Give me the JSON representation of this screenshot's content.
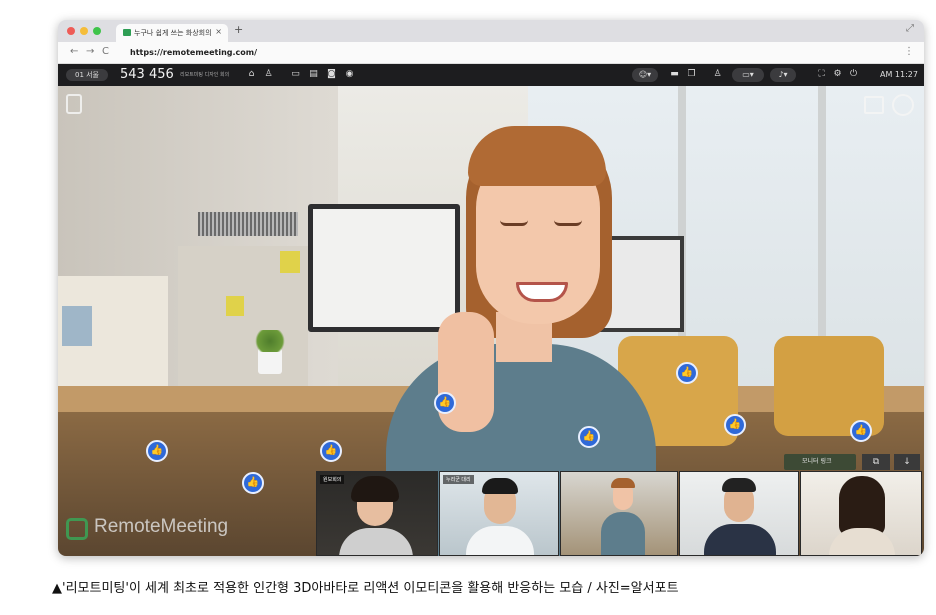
{
  "browser": {
    "tab_title": "누구나 쉽게 쓰는 화상회의",
    "tab_close": "×",
    "new_tab": "+",
    "url": "https://remotemeeting.com/",
    "back": "←",
    "forward": "→",
    "reload": "C"
  },
  "toolbar": {
    "room_tag": "01 서울",
    "room_number": "543 456",
    "room_desc": "리모트미팅 디자인 회의",
    "clock": "AM 11:27"
  },
  "scene": {
    "logo_text": "RemoteMeeting",
    "share_badge": "모니터 링크",
    "thumbnails": [
      {
        "label": "원보회의"
      },
      {
        "label": "누리군 대리"
      },
      {
        "label": ""
      },
      {
        "label": ""
      },
      {
        "label": ""
      }
    ]
  },
  "caption": "▲'리모트미팅'이 세계 최초로 적용한 인간형 3D아바타로 리액션 이모티콘을 활용해 반응하는 모습 / 사진=알서포트",
  "colors": {
    "like": "#2f69d8",
    "toolbar": "#1d1d1f",
    "brand_green": "#2e9e54"
  }
}
